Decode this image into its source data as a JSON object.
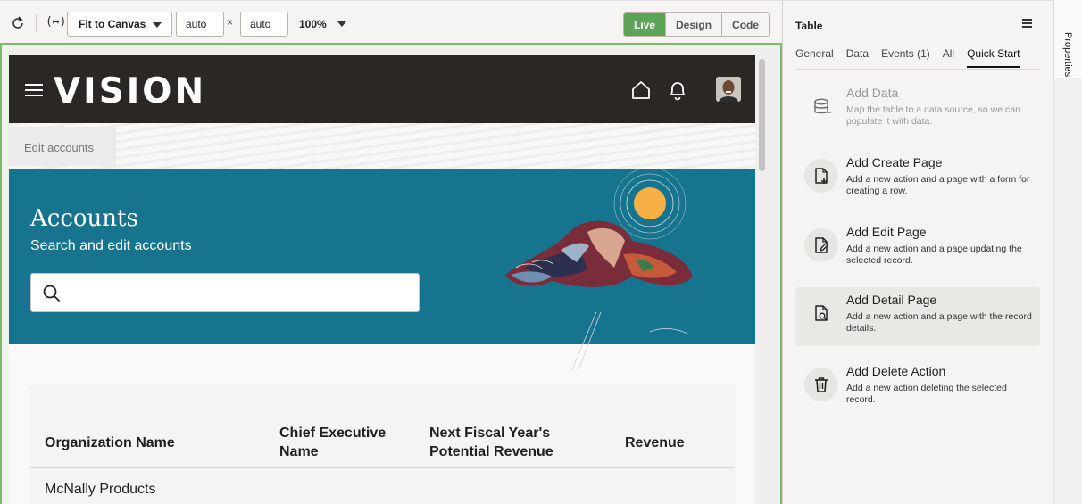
{
  "toolbar": {
    "fit_label": "Fit to Canvas",
    "width_value": "auto",
    "height_value": "auto",
    "times": "×",
    "zoom": "100%",
    "vars_label": "(↦)",
    "modes": [
      "Live",
      "Design",
      "Code"
    ],
    "active_mode": "Live"
  },
  "app": {
    "brand": "VISION",
    "breadcrumb": "Edit accounts",
    "hero_title": "Accounts",
    "hero_subtitle": "Search and edit accounts",
    "search_placeholder": "",
    "table": {
      "headers": [
        "Organization Name",
        "Chief Executive Name",
        "Next Fiscal Year's Potential Revenue",
        "Revenue"
      ],
      "rows": [
        [
          "McNally Products"
        ]
      ]
    }
  },
  "panel": {
    "title": "Table",
    "tabs": [
      "General",
      "Data",
      "Events (1)",
      "All",
      "Quick Start"
    ],
    "active_tab": "Quick Start",
    "items": [
      {
        "title": "Add Data",
        "desc": "Map the table to a data source, so we can populate it with data.",
        "icon": "database-icon"
      },
      {
        "title": "Add Create Page",
        "desc": "Add a new action and a page with a form for creating a row.",
        "icon": "file-plus-icon"
      },
      {
        "title": "Add Edit Page",
        "desc": "Add a new action and a page updating the selected record.",
        "icon": "file-edit-icon"
      },
      {
        "title": "Add Detail Page",
        "desc": "Add a new action and a page with the record details.",
        "icon": "file-search-icon"
      },
      {
        "title": "Add Delete Action",
        "desc": "Add a new action deleting the selected record.",
        "icon": "trash-icon"
      }
    ],
    "side_tab": "Properties"
  },
  "colors": {
    "live_green": "#5da357",
    "hero_blue": "#16748f",
    "header_dark": "#2b2725",
    "canvas_border": "#7cb86e"
  }
}
